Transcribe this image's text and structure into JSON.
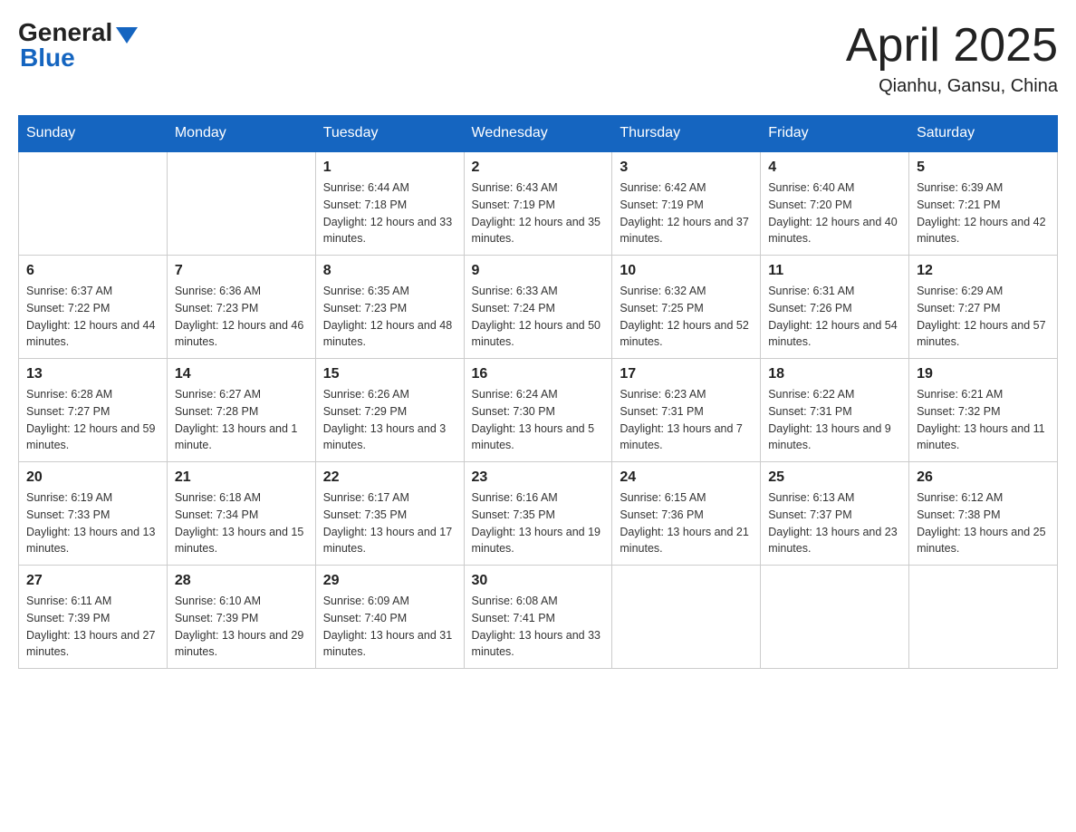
{
  "header": {
    "logo_general": "General",
    "logo_blue": "Blue",
    "main_title": "April 2025",
    "subtitle": "Qianhu, Gansu, China"
  },
  "days_of_week": [
    "Sunday",
    "Monday",
    "Tuesday",
    "Wednesday",
    "Thursday",
    "Friday",
    "Saturday"
  ],
  "weeks": [
    [
      {
        "day": "",
        "sunrise": "",
        "sunset": "",
        "daylight": ""
      },
      {
        "day": "",
        "sunrise": "",
        "sunset": "",
        "daylight": ""
      },
      {
        "day": "1",
        "sunrise": "Sunrise: 6:44 AM",
        "sunset": "Sunset: 7:18 PM",
        "daylight": "Daylight: 12 hours and 33 minutes."
      },
      {
        "day": "2",
        "sunrise": "Sunrise: 6:43 AM",
        "sunset": "Sunset: 7:19 PM",
        "daylight": "Daylight: 12 hours and 35 minutes."
      },
      {
        "day": "3",
        "sunrise": "Sunrise: 6:42 AM",
        "sunset": "Sunset: 7:19 PM",
        "daylight": "Daylight: 12 hours and 37 minutes."
      },
      {
        "day": "4",
        "sunrise": "Sunrise: 6:40 AM",
        "sunset": "Sunset: 7:20 PM",
        "daylight": "Daylight: 12 hours and 40 minutes."
      },
      {
        "day": "5",
        "sunrise": "Sunrise: 6:39 AM",
        "sunset": "Sunset: 7:21 PM",
        "daylight": "Daylight: 12 hours and 42 minutes."
      }
    ],
    [
      {
        "day": "6",
        "sunrise": "Sunrise: 6:37 AM",
        "sunset": "Sunset: 7:22 PM",
        "daylight": "Daylight: 12 hours and 44 minutes."
      },
      {
        "day": "7",
        "sunrise": "Sunrise: 6:36 AM",
        "sunset": "Sunset: 7:23 PM",
        "daylight": "Daylight: 12 hours and 46 minutes."
      },
      {
        "day": "8",
        "sunrise": "Sunrise: 6:35 AM",
        "sunset": "Sunset: 7:23 PM",
        "daylight": "Daylight: 12 hours and 48 minutes."
      },
      {
        "day": "9",
        "sunrise": "Sunrise: 6:33 AM",
        "sunset": "Sunset: 7:24 PM",
        "daylight": "Daylight: 12 hours and 50 minutes."
      },
      {
        "day": "10",
        "sunrise": "Sunrise: 6:32 AM",
        "sunset": "Sunset: 7:25 PM",
        "daylight": "Daylight: 12 hours and 52 minutes."
      },
      {
        "day": "11",
        "sunrise": "Sunrise: 6:31 AM",
        "sunset": "Sunset: 7:26 PM",
        "daylight": "Daylight: 12 hours and 54 minutes."
      },
      {
        "day": "12",
        "sunrise": "Sunrise: 6:29 AM",
        "sunset": "Sunset: 7:27 PM",
        "daylight": "Daylight: 12 hours and 57 minutes."
      }
    ],
    [
      {
        "day": "13",
        "sunrise": "Sunrise: 6:28 AM",
        "sunset": "Sunset: 7:27 PM",
        "daylight": "Daylight: 12 hours and 59 minutes."
      },
      {
        "day": "14",
        "sunrise": "Sunrise: 6:27 AM",
        "sunset": "Sunset: 7:28 PM",
        "daylight": "Daylight: 13 hours and 1 minute."
      },
      {
        "day": "15",
        "sunrise": "Sunrise: 6:26 AM",
        "sunset": "Sunset: 7:29 PM",
        "daylight": "Daylight: 13 hours and 3 minutes."
      },
      {
        "day": "16",
        "sunrise": "Sunrise: 6:24 AM",
        "sunset": "Sunset: 7:30 PM",
        "daylight": "Daylight: 13 hours and 5 minutes."
      },
      {
        "day": "17",
        "sunrise": "Sunrise: 6:23 AM",
        "sunset": "Sunset: 7:31 PM",
        "daylight": "Daylight: 13 hours and 7 minutes."
      },
      {
        "day": "18",
        "sunrise": "Sunrise: 6:22 AM",
        "sunset": "Sunset: 7:31 PM",
        "daylight": "Daylight: 13 hours and 9 minutes."
      },
      {
        "day": "19",
        "sunrise": "Sunrise: 6:21 AM",
        "sunset": "Sunset: 7:32 PM",
        "daylight": "Daylight: 13 hours and 11 minutes."
      }
    ],
    [
      {
        "day": "20",
        "sunrise": "Sunrise: 6:19 AM",
        "sunset": "Sunset: 7:33 PM",
        "daylight": "Daylight: 13 hours and 13 minutes."
      },
      {
        "day": "21",
        "sunrise": "Sunrise: 6:18 AM",
        "sunset": "Sunset: 7:34 PM",
        "daylight": "Daylight: 13 hours and 15 minutes."
      },
      {
        "day": "22",
        "sunrise": "Sunrise: 6:17 AM",
        "sunset": "Sunset: 7:35 PM",
        "daylight": "Daylight: 13 hours and 17 minutes."
      },
      {
        "day": "23",
        "sunrise": "Sunrise: 6:16 AM",
        "sunset": "Sunset: 7:35 PM",
        "daylight": "Daylight: 13 hours and 19 minutes."
      },
      {
        "day": "24",
        "sunrise": "Sunrise: 6:15 AM",
        "sunset": "Sunset: 7:36 PM",
        "daylight": "Daylight: 13 hours and 21 minutes."
      },
      {
        "day": "25",
        "sunrise": "Sunrise: 6:13 AM",
        "sunset": "Sunset: 7:37 PM",
        "daylight": "Daylight: 13 hours and 23 minutes."
      },
      {
        "day": "26",
        "sunrise": "Sunrise: 6:12 AM",
        "sunset": "Sunset: 7:38 PM",
        "daylight": "Daylight: 13 hours and 25 minutes."
      }
    ],
    [
      {
        "day": "27",
        "sunrise": "Sunrise: 6:11 AM",
        "sunset": "Sunset: 7:39 PM",
        "daylight": "Daylight: 13 hours and 27 minutes."
      },
      {
        "day": "28",
        "sunrise": "Sunrise: 6:10 AM",
        "sunset": "Sunset: 7:39 PM",
        "daylight": "Daylight: 13 hours and 29 minutes."
      },
      {
        "day": "29",
        "sunrise": "Sunrise: 6:09 AM",
        "sunset": "Sunset: 7:40 PM",
        "daylight": "Daylight: 13 hours and 31 minutes."
      },
      {
        "day": "30",
        "sunrise": "Sunrise: 6:08 AM",
        "sunset": "Sunset: 7:41 PM",
        "daylight": "Daylight: 13 hours and 33 minutes."
      },
      {
        "day": "",
        "sunrise": "",
        "sunset": "",
        "daylight": ""
      },
      {
        "day": "",
        "sunrise": "",
        "sunset": "",
        "daylight": ""
      },
      {
        "day": "",
        "sunrise": "",
        "sunset": "",
        "daylight": ""
      }
    ]
  ]
}
